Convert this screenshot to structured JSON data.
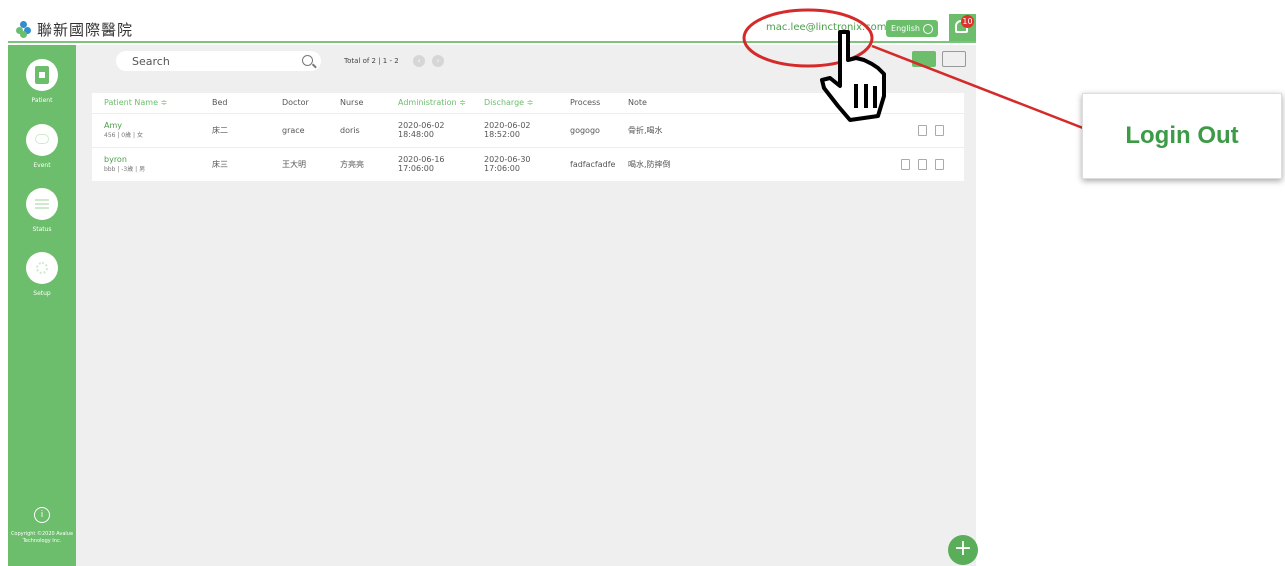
{
  "header": {
    "hospital_name": "聯新國際醫院",
    "user_email": "mac.lee@linctronix.com",
    "language_button": "English",
    "notification_count": "10"
  },
  "sidebar": {
    "items": [
      {
        "label": "Patient",
        "icon": "patient-icon"
      },
      {
        "label": "Event",
        "icon": "chat-icon"
      },
      {
        "label": "Status",
        "icon": "list-icon"
      },
      {
        "label": "Setup",
        "icon": "gear-icon"
      }
    ],
    "copyright": "Copyright ©2020 Avalue Technology Inc."
  },
  "toolbar": {
    "search_placeholder": "Search",
    "pagination_text": "Total of 2 | 1 - 2"
  },
  "table": {
    "columns": [
      "Patient Name ≑",
      "Bed",
      "Doctor",
      "Nurse",
      "Administration ≑",
      "Discharge ≑",
      "Process",
      "Note"
    ],
    "rows": [
      {
        "name": "Amy",
        "sub": "456 | 0歲 | 女",
        "bed": "床二",
        "doctor": "grace",
        "nurse": "doris",
        "administration": "2020-06-02 18:48:00",
        "discharge": "2020-06-02 18:52:00",
        "process": "gogogo",
        "note": "骨折,喝水"
      },
      {
        "name": "byron",
        "sub": "bbb | -3歲 | 男",
        "bed": "床三",
        "doctor": "王大明",
        "nurse": "方亮亮",
        "administration": "2020-06-16 17:06:00",
        "discharge": "2020-06-30 17:06:00",
        "process": "fadfacfadfe",
        "note": "喝水,防摔倒"
      }
    ]
  },
  "annotation": {
    "callout_text": "Login Out"
  },
  "colors": {
    "accent": "#6cbd6c",
    "annotation_red": "#d42a2a",
    "callout_text": "#3d9a47"
  }
}
